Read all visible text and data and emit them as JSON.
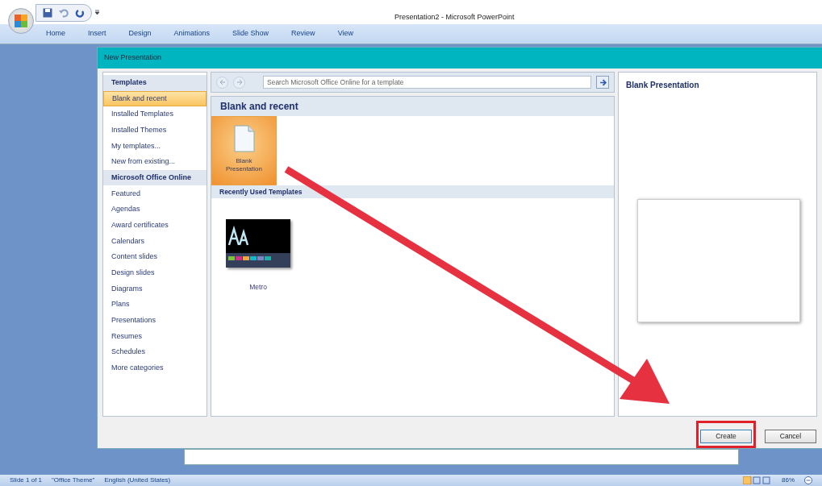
{
  "window": {
    "title": "Presentation2 - Microsoft PowerPoint"
  },
  "ribbon_tabs": [
    "Home",
    "Insert",
    "Design",
    "Animations",
    "Slide Show",
    "Review",
    "View"
  ],
  "dialog": {
    "title": "New Presentation",
    "sidebar": [
      {
        "heading": "Templates",
        "items": [
          {
            "label": "Blank and recent",
            "selected": true
          },
          {
            "label": "Installed Templates",
            "selected": false
          },
          {
            "label": "Installed Themes",
            "selected": false
          },
          {
            "label": "My templates...",
            "selected": false
          },
          {
            "label": "New from existing...",
            "selected": false
          }
        ]
      },
      {
        "heading": "Microsoft Office Online",
        "items": [
          {
            "label": "Featured",
            "selected": false
          },
          {
            "label": "Agendas",
            "selected": false
          },
          {
            "label": "Award certificates",
            "selected": false
          },
          {
            "label": "Calendars",
            "selected": false
          },
          {
            "label": "Content slides",
            "selected": false
          },
          {
            "label": "Design slides",
            "selected": false
          },
          {
            "label": "Diagrams",
            "selected": false
          },
          {
            "label": "Plans",
            "selected": false
          },
          {
            "label": "Presentations",
            "selected": false
          },
          {
            "label": "Resumes",
            "selected": false
          },
          {
            "label": "Schedules",
            "selected": false
          },
          {
            "label": "More categories",
            "selected": false
          }
        ]
      }
    ],
    "search": {
      "placeholder": "Search Microsoft Office Online for a template"
    },
    "section_title": "Blank and recent",
    "blank_template": {
      "label": "Blank Presentation",
      "selected": true
    },
    "recent_heading": "Recently Used Templates",
    "recent_templates": [
      {
        "label": "Metro",
        "selected": false
      }
    ],
    "preview_title": "Blank Presentation",
    "buttons": [
      {
        "label": "Create",
        "highlighted": true
      },
      {
        "label": "Cancel",
        "highlighted": false
      }
    ]
  },
  "status_bar": {
    "items": [
      "Slide 1 of 1",
      "\"Office Theme\"",
      "English (United States)"
    ],
    "zoom": "86%"
  }
}
